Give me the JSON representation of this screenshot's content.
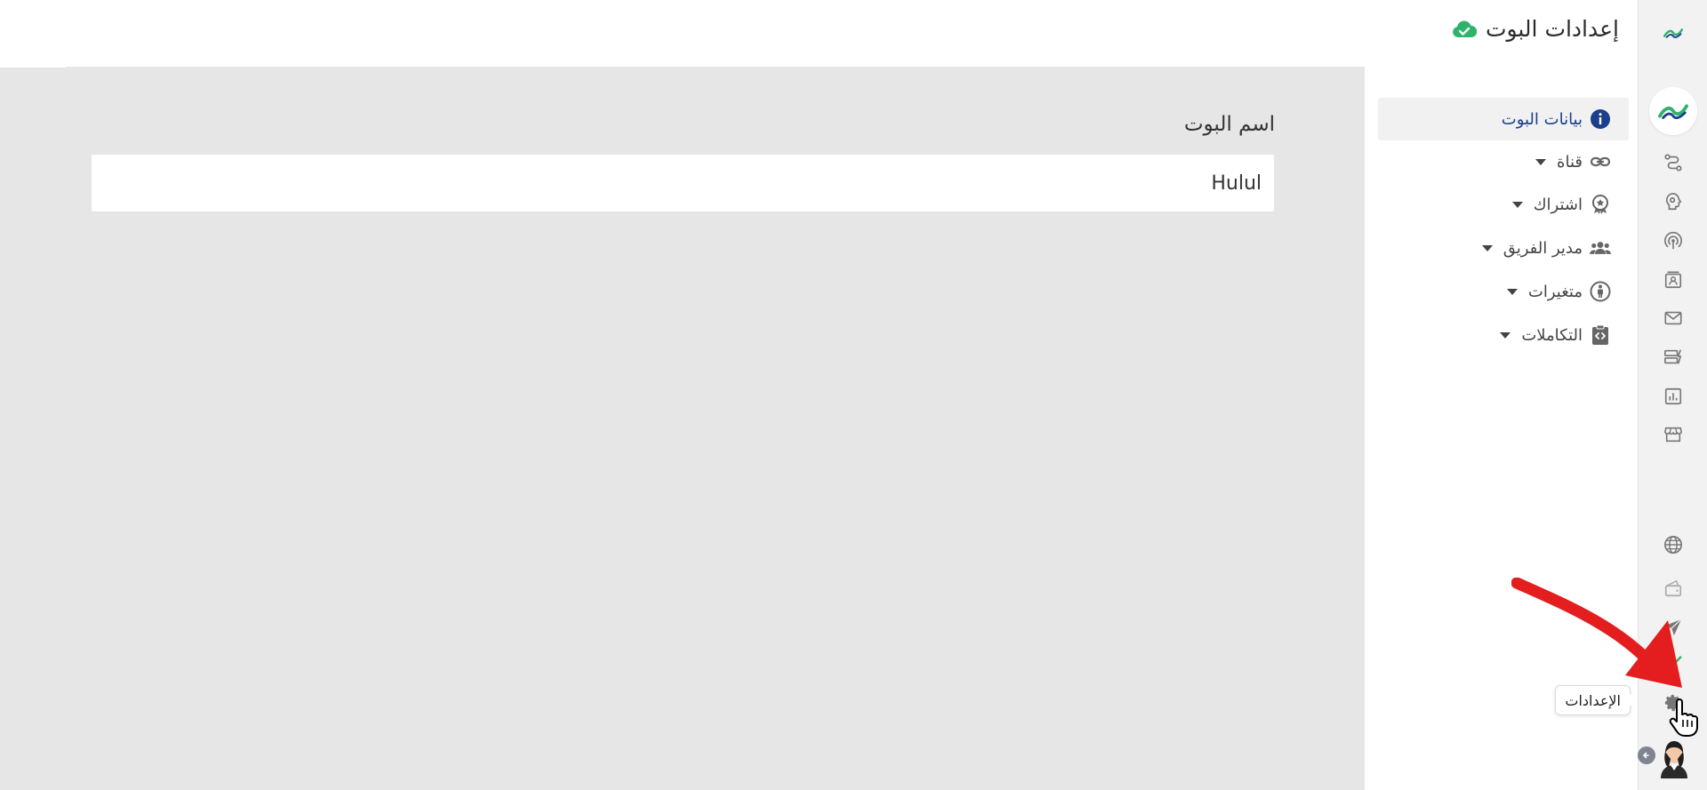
{
  "header": {
    "title": "إعدادات البوت"
  },
  "settings_menu": {
    "items": [
      {
        "label": "بيانات البوت",
        "icon": "info-icon",
        "active": true
      },
      {
        "label": "قناة",
        "icon": "link-icon",
        "active": false
      },
      {
        "label": "اشتراك",
        "icon": "award-icon",
        "active": false
      },
      {
        "label": "مدير الفريق",
        "icon": "users-icon",
        "active": false
      },
      {
        "label": "متغيرات",
        "icon": "variables-icon",
        "active": false
      },
      {
        "label": "التكاملات",
        "icon": "integrations-icon",
        "active": false
      }
    ]
  },
  "main": {
    "bot_name_label": "اسم البوت",
    "bot_name_value": "Hulul"
  },
  "tooltip": {
    "text": "الإعدادات"
  },
  "colors": {
    "accent_blue": "#1b3f8c",
    "success_green": "#2fb36b",
    "annotation_red": "#e41e1e",
    "panel_gray": "#e6e6e6"
  }
}
